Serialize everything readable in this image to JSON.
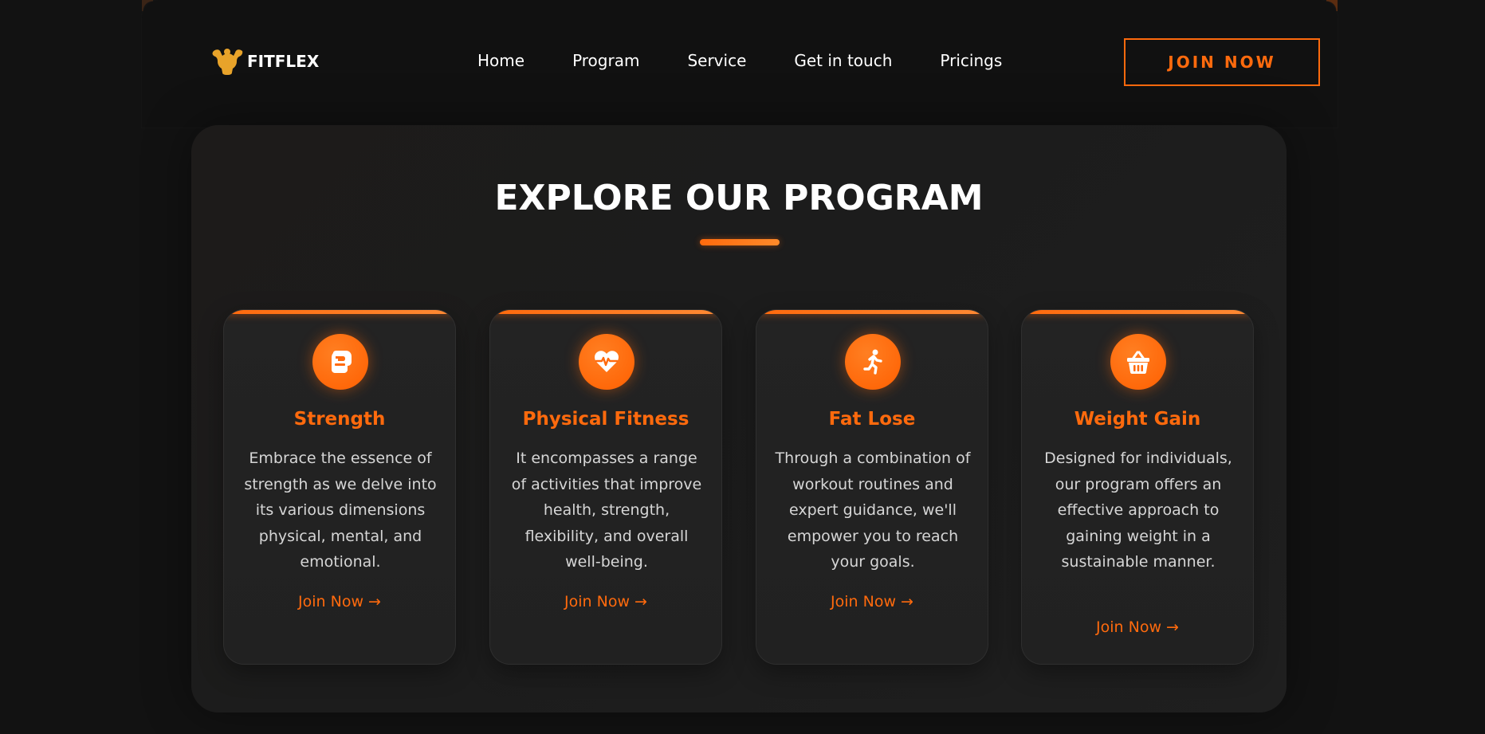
{
  "brand": {
    "name": "FITFLEX",
    "icon": "flexing-muscle-icon"
  },
  "nav": {
    "items": [
      {
        "label": "Home"
      },
      {
        "label": "Program"
      },
      {
        "label": "Service"
      },
      {
        "label": "Get in touch"
      },
      {
        "label": "Pricings"
      }
    ]
  },
  "header": {
    "cta_label": "JOIN NOW"
  },
  "section": {
    "title": "EXPLORE OUR PROGRAM"
  },
  "programs": [
    {
      "icon": "boxing-glove-icon",
      "title": "Strength",
      "description": "Embrace the essence of strength as we delve into its various dimensions physical, mental, and emotional.",
      "link_label": "Join Now →"
    },
    {
      "icon": "heart-pulse-icon",
      "title": "Physical Fitness",
      "description": "It encompasses a range of activities that improve health, strength, flexibility, and overall well-being.",
      "link_label": "Join Now →"
    },
    {
      "icon": "running-person-icon",
      "title": "Fat Lose",
      "description": "Through a combination of workout routines and expert guidance, we'll empower you to reach your goals.",
      "link_label": "Join Now →"
    },
    {
      "icon": "shopping-basket-icon",
      "title": "Weight Gain",
      "description": "Designed for individuals, our program offers an effective approach to gaining weight in a sustainable manner.",
      "link_label": "Join Now →"
    }
  ],
  "colors": {
    "accent": "#ff6a0d",
    "background": "#121212",
    "card": "#222222",
    "text": "#ffffff",
    "muted_text": "#d6d6d6"
  }
}
